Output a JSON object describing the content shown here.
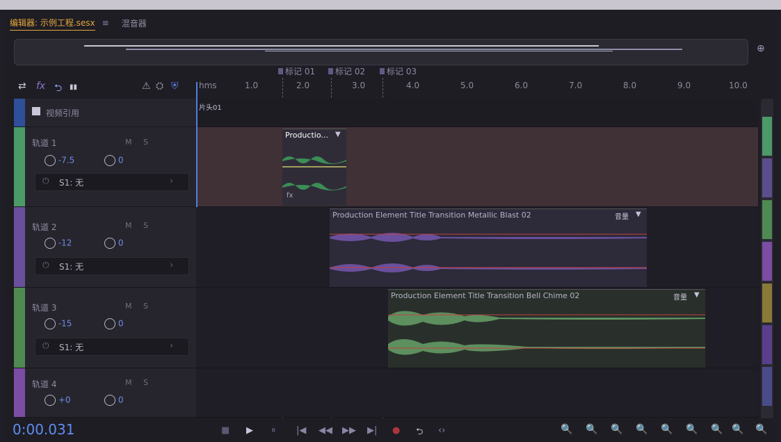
{
  "tabs": {
    "editor_label": "编辑器: 示例工程.sesx",
    "menu_glyph": "≡",
    "mixer_label": "混音器"
  },
  "markers": [
    {
      "label": "标记 01"
    },
    {
      "label": "标记 02"
    },
    {
      "label": "标记 03"
    }
  ],
  "toolbar": {
    "swap_glyph": "⇄",
    "fx_label": "fx",
    "send_glyph": "⮌",
    "meter_glyph": "▮▮",
    "warn_glyph": "⚠",
    "person_glyph": "⛭",
    "headphone_glyph": "⛨"
  },
  "ruler": {
    "unit": "hms",
    "labels": [
      "1.0",
      "2.0",
      "3.0",
      "4.0",
      "5.0",
      "6.0",
      "7.0",
      "8.0",
      "9.0",
      "10.0"
    ],
    "cue_label": "片头01"
  },
  "video_track": {
    "label": "视频引用"
  },
  "tracks": [
    {
      "name": "轨道 1",
      "m": "M",
      "s": "S",
      "volume": "-7.5",
      "pan": "0",
      "send": "S1: 无",
      "color": "#4c9a68"
    },
    {
      "name": "轨道 2",
      "m": "M",
      "s": "S",
      "volume": "-12",
      "pan": "0",
      "send": "S1: 无",
      "color": "#6a4f9c"
    },
    {
      "name": "轨道 3",
      "m": "M",
      "s": "S",
      "volume": "-15",
      "pan": "0",
      "send": "S1: 无",
      "color": "#4e8a52"
    },
    {
      "name": "轨道 4",
      "m": "M",
      "s": "S",
      "volume": "+0",
      "pan": "0",
      "send": "",
      "color": "#7b4da3"
    }
  ],
  "clips": {
    "clip1": {
      "title": "Productio...",
      "dropdown": "▼",
      "fx": "fx"
    },
    "clip2": {
      "title": "Production Element Title Transition Metallic Blast 02",
      "volume_label": "音量",
      "dropdown": "▼"
    },
    "clip3": {
      "title": "Production Element Title Transition Bell Chime 02",
      "volume_label": "音量",
      "dropdown": "▼"
    }
  },
  "transport": {
    "time": "0:00.031",
    "buttons": [
      "■",
      "▶",
      "⏸",
      "|◀",
      "◀◀",
      "▶▶",
      "▶|",
      "●",
      "⮌",
      "‹›"
    ]
  },
  "zoom_buttons": [
    "🔍",
    "🔍",
    "🔍",
    "🔍",
    "🔍",
    "🔍",
    "🔍",
    "🔍",
    "🔍"
  ],
  "colors": {
    "accent": "#e6a83c",
    "time_blue": "#5e8ef3",
    "playhead": "#4f80e0",
    "envelope_red": "#c3423f"
  }
}
